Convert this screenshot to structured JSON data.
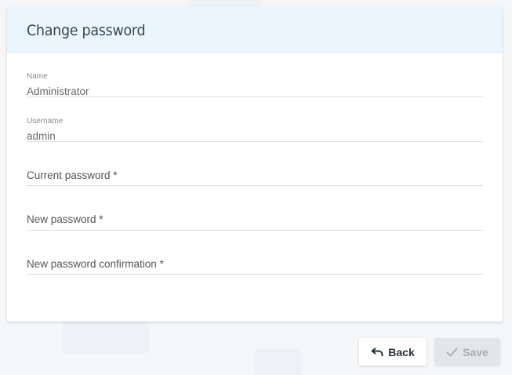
{
  "card": {
    "title": "Change password"
  },
  "fields": {
    "name": {
      "label": "Name",
      "value": "Administrator"
    },
    "username": {
      "label": "Username",
      "value": "admin"
    },
    "current_password": {
      "label": "Current password *"
    },
    "new_password": {
      "label": "New password *"
    },
    "new_password_confirmation": {
      "label": "New password confirmation *"
    }
  },
  "actions": {
    "back_label": "Back",
    "save_label": "Save"
  },
  "icons": {
    "back": "undo-arrow-icon",
    "save": "check-icon"
  },
  "colors": {
    "header_bg": "#eaf5fe",
    "disabled_button": "#e3e5e8"
  }
}
